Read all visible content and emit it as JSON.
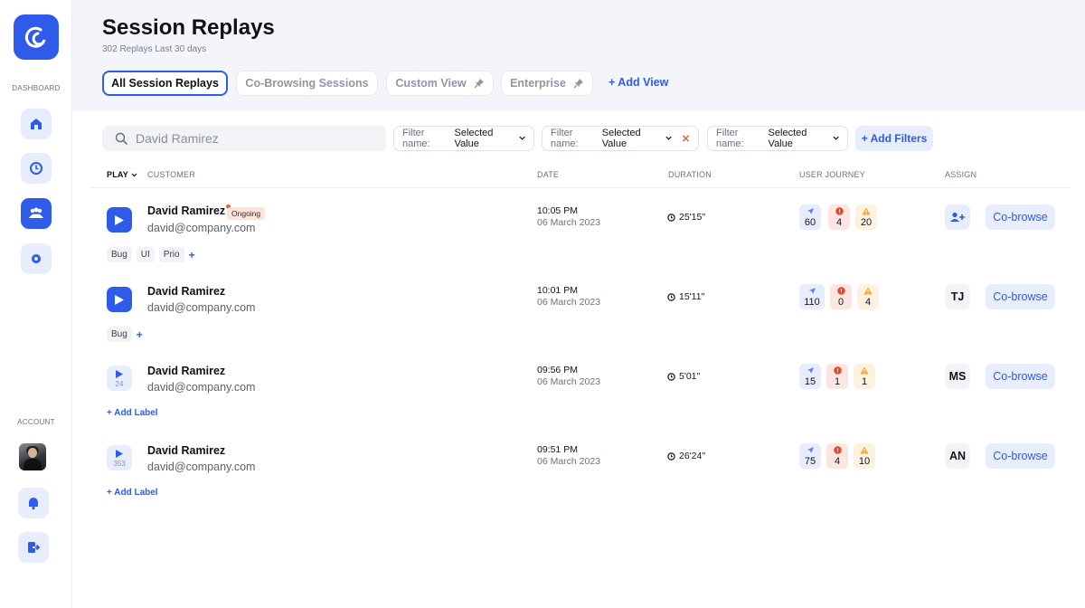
{
  "sidebar": {
    "dashboard_label": "DASHBOARD",
    "account_label": "ACCOUNT"
  },
  "header": {
    "title": "Session Replays",
    "subtitle": "302 Replays Last 30 days",
    "tabs": [
      {
        "label": "All Session Replays"
      },
      {
        "label": "Co-Browsing Sessions"
      },
      {
        "label": "Custom View"
      },
      {
        "label": "Enterprise"
      }
    ],
    "add_view": "+ Add View"
  },
  "search": {
    "placeholder": "David Ramirez"
  },
  "filters": [
    {
      "name": "Filter name:",
      "value": "Selected Value"
    },
    {
      "name": "Filter name:",
      "value": "Selected Value"
    },
    {
      "name": "Filter name:",
      "value": "Selected Value"
    }
  ],
  "add_filters": "+ Add Filters",
  "columns": {
    "play": "PLAY",
    "customer": "CUSTOMER",
    "date": "DATE",
    "duration": "DURATION",
    "journey": "USER JOURNEY",
    "assign": "ASSIGN"
  },
  "rows": [
    {
      "name": "David Ramirez",
      "status": "Ongoing",
      "email": "david@company.com",
      "time": "10:05 PM",
      "date": "06 March 2023",
      "duration": "25'15\"",
      "nav": "60",
      "errors": "4",
      "warnings": "20",
      "assign": "",
      "tags": [
        "Bug",
        "UI",
        "Prio"
      ],
      "cobrowse": "Co-browse"
    },
    {
      "name": "David Ramirez",
      "email": "david@company.com",
      "time": "10:01 PM",
      "date": "06 March 2023",
      "duration": "15'11\"",
      "nav": "110",
      "errors": "0",
      "warnings": "4",
      "assign": "TJ",
      "tags": [
        "Bug"
      ],
      "cobrowse": "Co-browse"
    },
    {
      "name": "David Ramirez",
      "email": "david@company.com",
      "time": "09:56 PM",
      "date": "06 March 2023",
      "duration": "5'01\"",
      "nav": "15",
      "errors": "1",
      "warnings": "1",
      "assign": "MS",
      "play_count": "24",
      "add_label": "+ Add Label",
      "cobrowse": "Co-browse"
    },
    {
      "name": "David Ramirez",
      "email": "david@company.com",
      "time": "09:51 PM",
      "date": "06 March 2023",
      "duration": "26'24\"",
      "nav": "75",
      "errors": "4",
      "warnings": "10",
      "assign": "AN",
      "play_count": "353",
      "add_label": "+ Add Label",
      "cobrowse": "Co-browse"
    }
  ],
  "colors": {
    "accent": "#2f5bea",
    "error": "#e8452c",
    "warning": "#f5a623"
  }
}
